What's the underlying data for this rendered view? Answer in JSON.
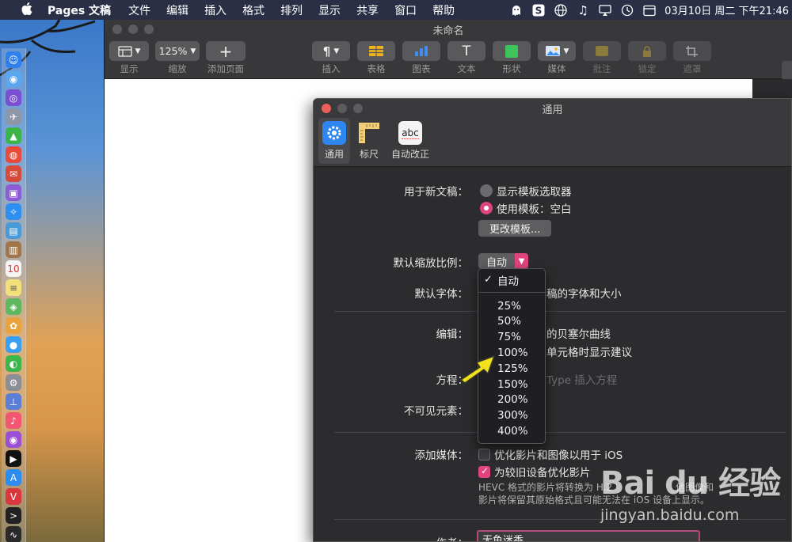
{
  "menubar": {
    "app_name": "Pages 文稿",
    "items": [
      "文件",
      "编辑",
      "插入",
      "格式",
      "排列",
      "显示",
      "共享",
      "窗口",
      "帮助"
    ],
    "clock": "03月10日 周二 下午21:46"
  },
  "window": {
    "title": "未命名",
    "toolbar": [
      {
        "label": "显示",
        "icon": "view-icon"
      },
      {
        "label": "缩放",
        "value": "125%"
      },
      {
        "label": "添加页面",
        "icon": "plus-icon"
      },
      {
        "label": "插入",
        "icon": "paragraph-icon"
      },
      {
        "label": "表格",
        "icon": "table-icon"
      },
      {
        "label": "图表",
        "icon": "chart-icon"
      },
      {
        "label": "文本",
        "icon": "text-icon"
      },
      {
        "label": "形状",
        "icon": "shape-icon"
      },
      {
        "label": "媒体",
        "icon": "media-icon"
      },
      {
        "label": "批注",
        "icon": "comment-icon"
      },
      {
        "label": "锁定",
        "icon": "lock-icon"
      },
      {
        "label": "遮罩",
        "icon": "crop-icon"
      }
    ]
  },
  "prefs": {
    "title": "通用",
    "tabs": [
      {
        "label": "通用",
        "icon": "gear-icon"
      },
      {
        "label": "标尺",
        "icon": "ruler-icon"
      },
      {
        "label": "自动改正",
        "icon": "abc-spellcheck-icon",
        "icon_text": "abc"
      }
    ],
    "new_doc": {
      "label": "用于新文稿：",
      "option_chooser": "显示模板选取器",
      "option_template": "使用模板：空白",
      "change_button": "更改模板..."
    },
    "zoom": {
      "label": "默认缩放比例：",
      "value": "自动"
    },
    "font": {
      "label": "默认字体：",
      "visible_text": "稿的字体和大小"
    },
    "editing": {
      "label": "编辑：",
      "line1": "的贝塞尔曲线",
      "line2": "单元格时显示建议"
    },
    "equation": {
      "label": "方程：",
      "visible_text": "Type 插入方程"
    },
    "invisibles": {
      "label": "不可见元素："
    },
    "media": {
      "label": "添加媒体：",
      "opt1": "优化影片和图像以用于 iOS",
      "opt2": "为较旧设备优化影片",
      "note_line1": "HEVC 格式的影片将转换为 H.2",
      "note_line1_end": "他图像和",
      "note_line2": "影片将保留其原始格式且可能无法在 iOS 设备上显示。"
    },
    "author": {
      "label": "作者：",
      "value": "无鱼迷香"
    }
  },
  "zoom_menu": {
    "options": [
      "自动",
      "25%",
      "50%",
      "75%",
      "100%",
      "125%",
      "150%",
      "200%",
      "300%",
      "400%"
    ],
    "selected": "自动"
  },
  "watermark": {
    "logo": "Bai du 经验",
    "url": "jingyan.baidu.com"
  },
  "colors": {
    "accent": "#e0447f",
    "window_bg": "#2c2c2e",
    "arrow": "#f2e21a"
  }
}
